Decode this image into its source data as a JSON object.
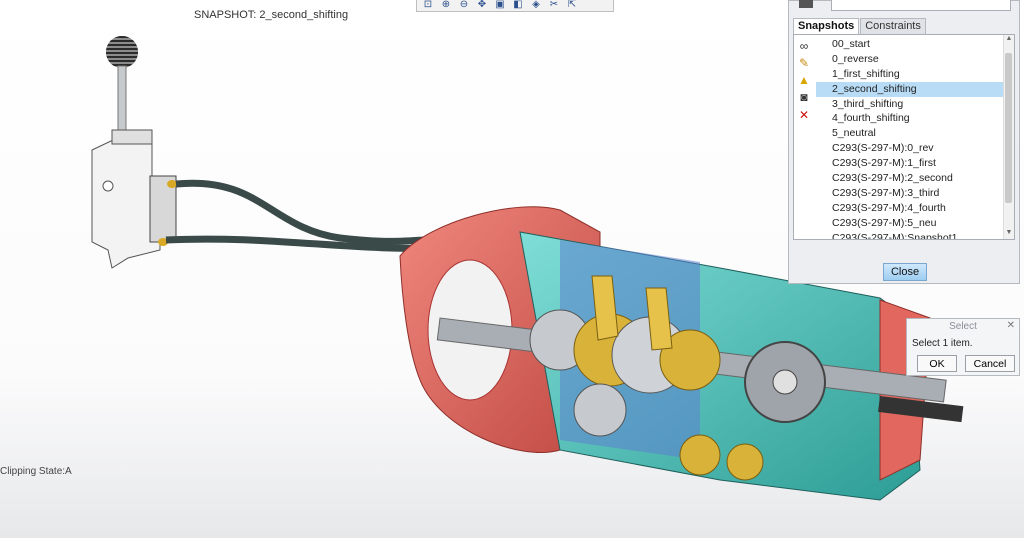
{
  "viewport": {
    "snapshot_title": "SNAPSHOT: 2_second_shifting",
    "clipping_state": "Clipping State:A"
  },
  "toolbar": {
    "icons": [
      "zoom-fit-icon",
      "zoom-in-icon",
      "zoom-out-icon",
      "pan-icon",
      "view-icon",
      "display-icon",
      "render-icon",
      "clip-icon",
      "explode-icon"
    ]
  },
  "panel": {
    "tabs": [
      {
        "label": "Snapshots",
        "active": true
      },
      {
        "label": "Constraints",
        "active": false
      }
    ],
    "side_icons": [
      "glasses-icon",
      "pencil-icon",
      "warning-icon",
      "camera-icon",
      "delete-icon"
    ],
    "items": [
      "00_start",
      "0_reverse",
      "1_first_shifting",
      "2_second_shifting",
      "3_third_shifting",
      "4_fourth_shifting",
      "5_neutral",
      "C293(S-297-M):0_rev",
      "C293(S-297-M):1_first",
      "C293(S-297-M):2_second",
      "C293(S-297-M):3_third",
      "C293(S-297-M):4_fourth",
      "C293(S-297-M):5_neu",
      "C293(S-297-M):Snapshot1"
    ],
    "selected_index": 3,
    "close_label": "Close"
  },
  "dialog": {
    "title": "Select",
    "message": "Select 1 item.",
    "ok_label": "OK",
    "cancel_label": "Cancel"
  },
  "colors": {
    "selection": "#b8dcf6",
    "housing_red": "#e2675f",
    "housing_teal": "#3fc1b8",
    "gear_gold": "#d9b23a",
    "shaft_gray": "#9a9fa6"
  }
}
